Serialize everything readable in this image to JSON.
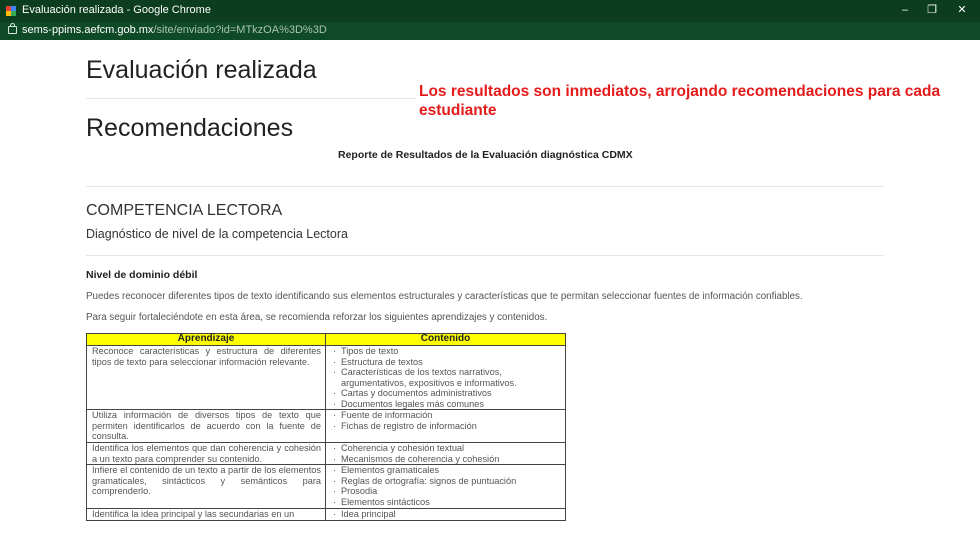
{
  "window": {
    "title": "Evaluación realizada - Google Chrome"
  },
  "address": {
    "domain": "sems-ppims.aefcm.gob.mx",
    "path": "/site/enviado?id=MTkzOA%3D%3D"
  },
  "page": {
    "title": "Evaluación realizada",
    "heading": "Recomendaciones",
    "report_title": "Reporte de Resultados de la Evaluación diagnóstica CDMX",
    "section_title": "COMPETENCIA LECTORA",
    "section_subtitle": "Diagnóstico de nivel de la competencia Lectora",
    "level": "Nivel de dominio débil",
    "paragraph1": "Puedes reconocer diferentes tipos de texto identificando sus elementos estructurales y características que te permitan seleccionar fuentes de información confiables.",
    "paragraph2": "Para seguir fortaleciéndote en esta área, se recomienda reforzar los siguientes aprendizajes y contenidos."
  },
  "annotation": {
    "text": "Los resultados son inmediatos, arrojando recomendaciones para cada estudiante",
    "color": "#e41b1b"
  },
  "table": {
    "headers": [
      "Aprendizaje",
      "Contenido"
    ],
    "header_color": "#ffff00",
    "rows": [
      {
        "aprendizaje": "Reconoce características y estructura de diferentes tipos de texto para seleccionar información relevante.",
        "contenido": [
          "Tipos de texto",
          "Estructura de textos",
          "Características de los textos narrativos, argumentativos, expositivos e informativos.",
          "Cartas y documentos administrativos",
          "Documentos legales más comunes"
        ]
      },
      {
        "aprendizaje": "Utiliza información de diversos tipos de texto que permiten identificarlos de acuerdo con la fuente de consulta.",
        "contenido": [
          "Fuente de información",
          "Fichas de registro de información"
        ]
      },
      {
        "aprendizaje": "Identifica los elementos que dan coherencia y cohesión a un texto para comprender su contenido.",
        "contenido": [
          "Coherencia y cohesión textual",
          "Mecanismos de coherencia y cohesión"
        ]
      },
      {
        "aprendizaje": "Infiere el contenido de un texto a partir de los elementos gramaticales, sintácticos y semánticos para comprenderlo.",
        "contenido": [
          "Elementos gramaticales",
          "Reglas de ortografía: signos de puntuación",
          "Prosodia",
          "Elementos sintácticos"
        ]
      },
      {
        "aprendizaje": "Identifica la idea principal y las secundarias en un",
        "contenido": [
          "Idea principal"
        ]
      }
    ]
  }
}
